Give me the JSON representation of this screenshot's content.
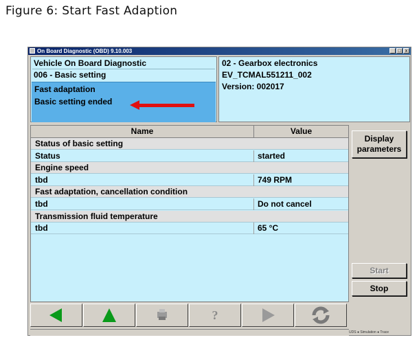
{
  "figure": {
    "caption": "Figure 6: Start Fast Adaption"
  },
  "window": {
    "title": "On Board Diagnostic (OBD) 9.10.003",
    "min_glyph": "_",
    "max_glyph": "□",
    "close_glyph": "x"
  },
  "info_left": {
    "line1": "Vehicle On Board Diagnostic",
    "line2": "006 - Basic setting",
    "status1": "Fast adaptation",
    "status2": "Basic setting ended"
  },
  "info_right": {
    "line1": "02 - Gearbox electronics",
    "line2": "EV_TCMAL551211_002",
    "line3": "Version: 002017"
  },
  "table": {
    "col_name": "Name",
    "col_value": "Value",
    "rows": [
      {
        "type": "group",
        "name": "Status of basic setting",
        "value": ""
      },
      {
        "type": "item",
        "name": "Status",
        "value": "started"
      },
      {
        "type": "group",
        "name": "Engine speed",
        "value": ""
      },
      {
        "type": "item",
        "name": "tbd",
        "value": "749 RPM"
      },
      {
        "type": "group",
        "name": "Fast adaptation, cancellation condition",
        "value": ""
      },
      {
        "type": "item",
        "name": "tbd",
        "value": "Do not cancel"
      },
      {
        "type": "group",
        "name": "Transmission fluid temperature",
        "value": ""
      },
      {
        "type": "item",
        "name": "tbd",
        "value": "65 °C"
      }
    ]
  },
  "side": {
    "display_line1": "Display",
    "display_line2": "parameters",
    "start": "Start",
    "stop": "Stop"
  },
  "toolbar": {
    "items": [
      "back-arrow-icon",
      "home-up-icon",
      "print-icon",
      "help-icon",
      "forward-arrow-icon",
      "refresh-icon"
    ],
    "help_glyph": "?"
  },
  "statusbar": {
    "text": "UDS  ● Simulation  ● Trace"
  },
  "colors": {
    "panel": "#c8f0fc",
    "status_box": "#5ab0e8",
    "arrow": "#e01010",
    "nav_green": "#0a9a1a"
  }
}
